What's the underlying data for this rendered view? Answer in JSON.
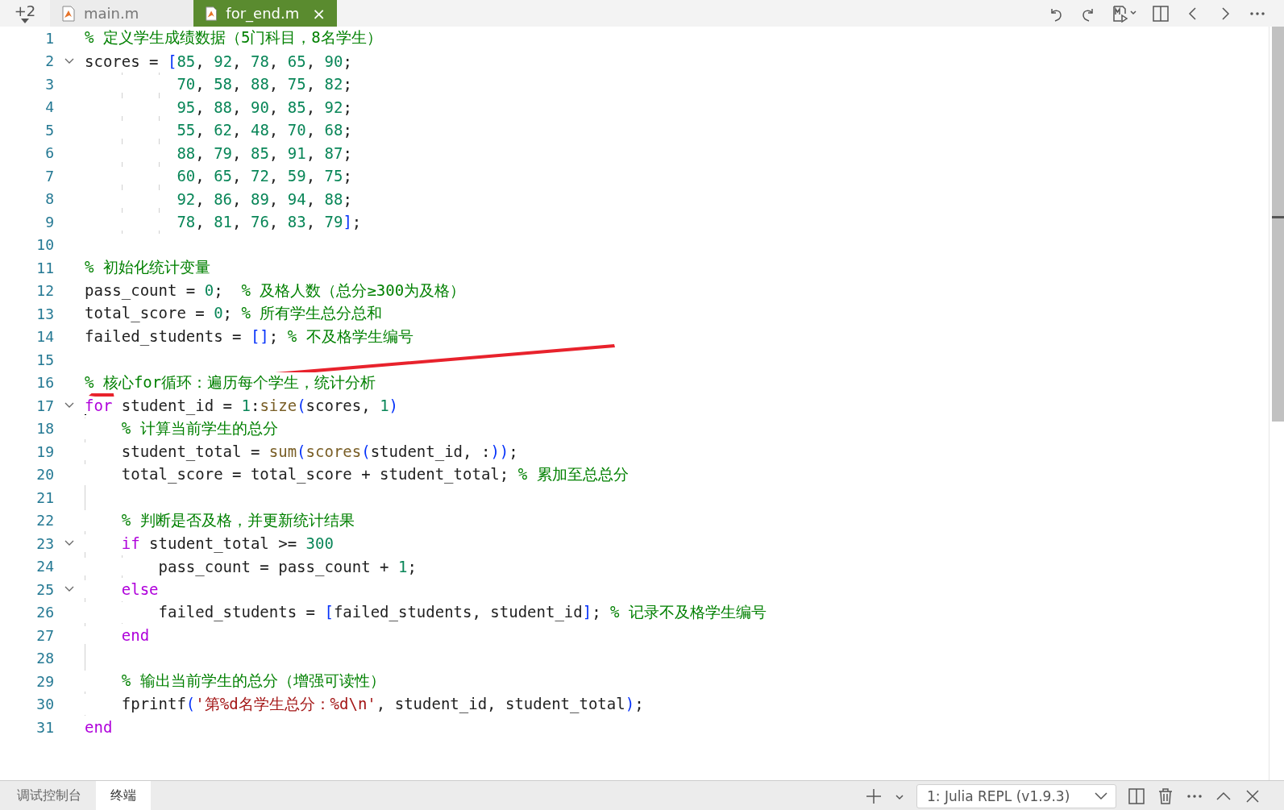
{
  "overflow_tabs": {
    "count": "+2"
  },
  "tabs": [
    {
      "label": "main.m",
      "selected": false
    },
    {
      "label": "for_end.m",
      "selected": true,
      "close": "×"
    }
  ],
  "editor": {
    "lines": [
      {
        "number": "1",
        "segments": [
          {
            "kind": "comment",
            "text": "% 定义学生成绩数据（5门科目，8名学生）"
          }
        ]
      },
      {
        "number": "2",
        "fold": {
          "expanded": true
        },
        "segments": [
          {
            "kind": "plain",
            "text": "scores = "
          },
          {
            "kind": "bracket",
            "text": "["
          },
          {
            "kind": "number",
            "text": "85"
          },
          {
            "kind": "plain",
            "text": ", "
          },
          {
            "kind": "number",
            "text": "92"
          },
          {
            "kind": "plain",
            "text": ", "
          },
          {
            "kind": "number",
            "text": "78"
          },
          {
            "kind": "plain",
            "text": ", "
          },
          {
            "kind": "number",
            "text": "65"
          },
          {
            "kind": "plain",
            "text": ", "
          },
          {
            "kind": "number",
            "text": "90"
          },
          {
            "kind": "plain",
            "text": ";"
          }
        ]
      },
      {
        "number": "3",
        "segments": [
          {
            "kind": "number",
            "text": "          70"
          },
          {
            "kind": "plain",
            "text": ", "
          },
          {
            "kind": "number",
            "text": "58"
          },
          {
            "kind": "plain",
            "text": ", "
          },
          {
            "kind": "number",
            "text": "88"
          },
          {
            "kind": "plain",
            "text": ", "
          },
          {
            "kind": "number",
            "text": "75"
          },
          {
            "kind": "plain",
            "text": ", "
          },
          {
            "kind": "number",
            "text": "82"
          },
          {
            "kind": "plain",
            "text": ";"
          }
        ]
      },
      {
        "number": "4",
        "segments": [
          {
            "kind": "number",
            "text": "          95"
          },
          {
            "kind": "plain",
            "text": ", "
          },
          {
            "kind": "number",
            "text": "88"
          },
          {
            "kind": "plain",
            "text": ", "
          },
          {
            "kind": "number",
            "text": "90"
          },
          {
            "kind": "plain",
            "text": ", "
          },
          {
            "kind": "number",
            "text": "85"
          },
          {
            "kind": "plain",
            "text": ", "
          },
          {
            "kind": "number",
            "text": "92"
          },
          {
            "kind": "plain",
            "text": ";"
          }
        ]
      },
      {
        "number": "5",
        "segments": [
          {
            "kind": "number",
            "text": "          55"
          },
          {
            "kind": "plain",
            "text": ", "
          },
          {
            "kind": "number",
            "text": "62"
          },
          {
            "kind": "plain",
            "text": ", "
          },
          {
            "kind": "number",
            "text": "48"
          },
          {
            "kind": "plain",
            "text": ", "
          },
          {
            "kind": "number",
            "text": "70"
          },
          {
            "kind": "plain",
            "text": ", "
          },
          {
            "kind": "number",
            "text": "68"
          },
          {
            "kind": "plain",
            "text": ";"
          }
        ]
      },
      {
        "number": "6",
        "segments": [
          {
            "kind": "number",
            "text": "          88"
          },
          {
            "kind": "plain",
            "text": ", "
          },
          {
            "kind": "number",
            "text": "79"
          },
          {
            "kind": "plain",
            "text": ", "
          },
          {
            "kind": "number",
            "text": "85"
          },
          {
            "kind": "plain",
            "text": ", "
          },
          {
            "kind": "number",
            "text": "91"
          },
          {
            "kind": "plain",
            "text": ", "
          },
          {
            "kind": "number",
            "text": "87"
          },
          {
            "kind": "plain",
            "text": ";"
          }
        ]
      },
      {
        "number": "7",
        "segments": [
          {
            "kind": "number",
            "text": "          60"
          },
          {
            "kind": "plain",
            "text": ", "
          },
          {
            "kind": "number",
            "text": "65"
          },
          {
            "kind": "plain",
            "text": ", "
          },
          {
            "kind": "number",
            "text": "72"
          },
          {
            "kind": "plain",
            "text": ", "
          },
          {
            "kind": "number",
            "text": "59"
          },
          {
            "kind": "plain",
            "text": ", "
          },
          {
            "kind": "number",
            "text": "75"
          },
          {
            "kind": "plain",
            "text": ";"
          }
        ]
      },
      {
        "number": "8",
        "segments": [
          {
            "kind": "number",
            "text": "          92"
          },
          {
            "kind": "plain",
            "text": ", "
          },
          {
            "kind": "number",
            "text": "86"
          },
          {
            "kind": "plain",
            "text": ", "
          },
          {
            "kind": "number",
            "text": "89"
          },
          {
            "kind": "plain",
            "text": ", "
          },
          {
            "kind": "number",
            "text": "94"
          },
          {
            "kind": "plain",
            "text": ", "
          },
          {
            "kind": "number",
            "text": "88"
          },
          {
            "kind": "plain",
            "text": ";"
          }
        ]
      },
      {
        "number": "9",
        "segments": [
          {
            "kind": "number",
            "text": "          78"
          },
          {
            "kind": "plain",
            "text": ", "
          },
          {
            "kind": "number",
            "text": "81"
          },
          {
            "kind": "plain",
            "text": ", "
          },
          {
            "kind": "number",
            "text": "76"
          },
          {
            "kind": "plain",
            "text": ", "
          },
          {
            "kind": "number",
            "text": "83"
          },
          {
            "kind": "plain",
            "text": ", "
          },
          {
            "kind": "number",
            "text": "79"
          },
          {
            "kind": "bracket",
            "text": "]"
          },
          {
            "kind": "plain",
            "text": ";"
          }
        ]
      },
      {
        "number": "10"
      },
      {
        "number": "11",
        "segments": [
          {
            "kind": "comment",
            "text": "% 初始化统计变量"
          }
        ]
      },
      {
        "number": "12",
        "segments": [
          {
            "kind": "plain",
            "text": "pass_count = "
          },
          {
            "kind": "number",
            "text": "0"
          },
          {
            "kind": "plain",
            "text": ";  "
          },
          {
            "kind": "comment",
            "text": "% 及格人数（总分≥300为及格）"
          }
        ]
      },
      {
        "number": "13",
        "segments": [
          {
            "kind": "plain",
            "text": "total_score = "
          },
          {
            "kind": "number",
            "text": "0"
          },
          {
            "kind": "plain",
            "text": "; "
          },
          {
            "kind": "comment",
            "text": "% 所有学生总分总和"
          }
        ]
      },
      {
        "number": "14",
        "segments": [
          {
            "kind": "plain",
            "text": "failed_students = "
          },
          {
            "kind": "bracket",
            "text": "[]"
          },
          {
            "kind": "plain",
            "text": "; "
          },
          {
            "kind": "comment",
            "text": "% 不及格学生编号"
          }
        ]
      },
      {
        "number": "15"
      },
      {
        "number": "16",
        "segments": [
          {
            "kind": "comment",
            "text": "% 核心for循环：遍历每个学生，统计分析"
          }
        ]
      },
      {
        "number": "17",
        "fold": {
          "expanded": true
        },
        "segments": [
          {
            "kind": "keyword",
            "text": "for"
          },
          {
            "kind": "plain",
            "text": " student_id = "
          },
          {
            "kind": "number",
            "text": "1"
          },
          {
            "kind": "plain",
            "text": ":"
          },
          {
            "kind": "function",
            "text": "size"
          },
          {
            "kind": "bracket",
            "text": "("
          },
          {
            "kind": "plain",
            "text": "scores, "
          },
          {
            "kind": "number",
            "text": "1"
          },
          {
            "kind": "bracket",
            "text": ")"
          }
        ]
      },
      {
        "number": "18",
        "segments": [
          {
            "kind": "comment",
            "text": "    % 计算当前学生的总分"
          }
        ]
      },
      {
        "number": "19",
        "segments": [
          {
            "kind": "plain",
            "text": "    student_total = "
          },
          {
            "kind": "function",
            "text": "sum"
          },
          {
            "kind": "bracket",
            "text": "("
          },
          {
            "kind": "function",
            "text": "scores"
          },
          {
            "kind": "bracket",
            "text": "("
          },
          {
            "kind": "plain",
            "text": "student_id, :"
          },
          {
            "kind": "bracket",
            "text": "))"
          },
          {
            "kind": "plain",
            "text": ";"
          }
        ]
      },
      {
        "number": "20",
        "segments": [
          {
            "kind": "plain",
            "text": "    total_score = total_score + student_total; "
          },
          {
            "kind": "comment",
            "text": "% 累加至总总分"
          }
        ]
      },
      {
        "number": "21"
      },
      {
        "number": "22",
        "segments": [
          {
            "kind": "comment",
            "text": "    % 判断是否及格，并更新统计结果"
          }
        ]
      },
      {
        "number": "23",
        "fold": {
          "expanded": true
        },
        "segments": [
          {
            "kind": "keyword",
            "text": "    if"
          },
          {
            "kind": "plain",
            "text": " student_total >= "
          },
          {
            "kind": "number",
            "text": "300"
          }
        ]
      },
      {
        "number": "24",
        "segments": [
          {
            "kind": "plain",
            "text": "        pass_count = pass_count + "
          },
          {
            "kind": "number",
            "text": "1"
          },
          {
            "kind": "plain",
            "text": ";"
          }
        ]
      },
      {
        "number": "25",
        "fold": {
          "expanded": true
        },
        "segments": [
          {
            "kind": "keyword",
            "text": "    else"
          }
        ]
      },
      {
        "number": "26",
        "segments": [
          {
            "kind": "plain",
            "text": "        failed_students = "
          },
          {
            "kind": "bracket",
            "text": "["
          },
          {
            "kind": "plain",
            "text": "failed_students, student_id"
          },
          {
            "kind": "bracket",
            "text": "]"
          },
          {
            "kind": "plain",
            "text": "; "
          },
          {
            "kind": "comment",
            "text": "% 记录不及格学生编号"
          }
        ]
      },
      {
        "number": "27",
        "segments": [
          {
            "kind": "keyword",
            "text": "    end"
          }
        ]
      },
      {
        "number": "28"
      },
      {
        "number": "29",
        "segments": [
          {
            "kind": "comment",
            "text": "    % 输出当前学生的总分（增强可读性）"
          }
        ]
      },
      {
        "number": "30",
        "segments": [
          {
            "kind": "plain",
            "text": "    fprintf"
          },
          {
            "kind": "bracket",
            "text": "("
          },
          {
            "kind": "string",
            "text": "'第%d名学生总分：%d\\n'"
          },
          {
            "kind": "plain",
            "text": ", student_id, student_total"
          },
          {
            "kind": "bracket",
            "text": ")"
          },
          {
            "kind": "plain",
            "text": ";"
          }
        ]
      },
      {
        "number": "31",
        "segments": [
          {
            "kind": "keyword",
            "text": "end"
          }
        ]
      }
    ]
  },
  "panel": {
    "tabs": [
      {
        "label": "调试控制台",
        "selected": false
      },
      {
        "label": "终端",
        "selected": true
      }
    ],
    "terminal_select": {
      "value": "1: Julia REPL (v1.9.3)"
    }
  }
}
